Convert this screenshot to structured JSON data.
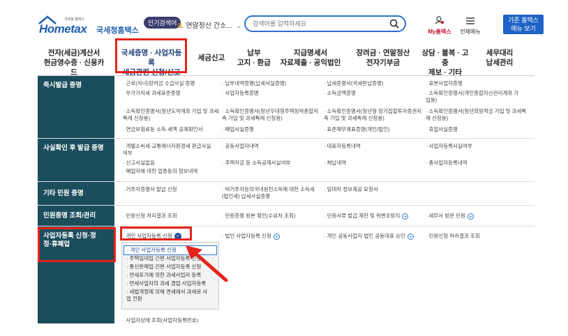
{
  "header": {
    "logo_brand": "Hometax",
    "logo_sub": "국세청홈택스",
    "logo_tiny": "국세청 홈택스",
    "popular_badge": "인기검색어",
    "popular_num": "6.",
    "popular_term": "연말정산 간소...",
    "search_placeholder": "검색어를 입력하세요",
    "my_hometax": "My홈택스",
    "all_menu": "전체메뉴",
    "basic_btn_line1": "기존 홈택스",
    "basic_btn_line2": "메뉴 보기"
  },
  "nav": [
    {
      "label": "전자(세금)계산서\n현금영수증 · 신용카드"
    },
    {
      "label": "국세증명 · 사업자등록\n세금관련 신청/신고"
    },
    {
      "label": "세금신고"
    },
    {
      "label": "납부\n고지 · 환급"
    },
    {
      "label": "지급명세서\n자료제출 · 공익법인"
    },
    {
      "label": "장려금 · 연말정산\n전자기부금"
    },
    {
      "label": "상담 · 불복 · 고충\n제보 · 기타"
    },
    {
      "label": "세무대리\n납세관리"
    }
  ],
  "rows": {
    "r1": {
      "head": "즉시발급 증명",
      "c1": "근로(자녀)장려금 수급사실 증명",
      "c2": "납부내역증명(납세사실증명)",
      "c3": "납세증명서(국세완납증명)",
      "c4": "표본사업자증명",
      "c5": "부가가치세 과세표준증명",
      "c6": "사업자등록증명",
      "c7": "소득금액증명",
      "c8": "소득확인증명서(개인종합자산관리계좌 가입용)",
      "c9": "소득확인증명서(청년도약계좌 가입 및 과세특례 신청용)",
      "c10": "소득확인증명서(청년우대형주택청약종합저축 가입 및 과세특례 신청용)",
      "c11": "소득확인증명서(청년형 장기집합투자증권저축 가입 및 과세특례 신청용)",
      "c12": "소득확인증명서(청년희망적금 가입 및 과세특례 신청용)",
      "c13": "연금보험료등 소득·세액 공제확인서",
      "c14": "폐업사실증명",
      "c15": "표준재무제표증명(개인/법인)",
      "c16": "휴업사실증명"
    },
    "r2": {
      "head": "사실확인 후 발급 증명",
      "c1": "개별소비세·교통에너지환경세 환급사실 여부",
      "c2": "공동사업자내역",
      "c3": "대표자등록내역",
      "c4": "사업자등록사실여부",
      "c5": "신고사실없음",
      "c6": "주택자금 등 소득공제사실여부",
      "c7": "체납내역",
      "c8": "총사업자등록내역",
      "c9": "폐업자에 대한 업종등의 정보내역"
    },
    "r3": {
      "head": "기타 민원 증명",
      "c1": "거주자증명서 발급 신청",
      "c2": "비거주자등의국내원천소득에 대한 소득세(법인세) 납세사실증명",
      "c3": "임대차 정보제공 요청서"
    },
    "r4": {
      "head": "민원증명 조회/관리",
      "c1": "민원신청 처리결과 조회",
      "c2": "민원증명 원본 확인(수요처 조회)",
      "c3": "민원서류 발급 제한 및 위변조방지",
      "c4": "세무서 방문 민원"
    },
    "r5": {
      "head": "사업자등록 신청·정정·휴폐업",
      "c1": "개인 사업자등록 신청",
      "c2": "법인 사업자등록 신청",
      "c3": "개인 공동사업자·법인 공동대표 승인",
      "c4": "민원신청 처리결과 조회",
      "c5": "사업자상태 조회(사업자등록번호)"
    }
  },
  "submenu": [
    "개인 사업자등록 신청",
    "주택임대업 간편 사업자등록 신청",
    "통신판매업 간편 사업자등록 신청",
    "면세포기에 의한 과세사업자 등록",
    "면세사업자의 과세 겸업 사업자등록",
    "세법개정에 의해 면세에서 과세로 사업 전환"
  ],
  "colors": {
    "left_col": "#1b4d5c",
    "highlight": "#e5231a",
    "brand": "#1f5fb0",
    "button": "#1f63c6"
  }
}
